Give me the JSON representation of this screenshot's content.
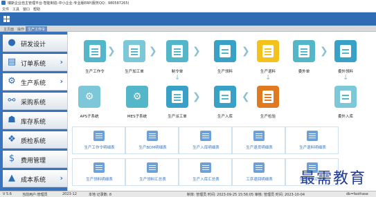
{
  "window": {
    "title": "瑞斯企业自主管理平台-智能制造-中小企业-专业版ERP(服务QQ：980587265)"
  },
  "menu": {
    "items": [
      "文件",
      "工具",
      "窗口",
      "帮助"
    ]
  },
  "tabs": [
    {
      "label": "主页面"
    },
    {
      "label": "操作"
    },
    {
      "label": "生产工作令"
    }
  ],
  "sidebar": {
    "items": [
      {
        "label": "研发设计",
        "icon": "user-icon"
      },
      {
        "label": "订单系统",
        "icon": "orders-icon"
      },
      {
        "label": "生产系统",
        "icon": "gear-icon"
      },
      {
        "label": "采购系统",
        "icon": "cart-icon"
      },
      {
        "label": "库存系统",
        "icon": "warehouse-icon"
      },
      {
        "label": "质检系统",
        "icon": "quality-icon"
      },
      {
        "label": "费用管理",
        "icon": "dollar-icon"
      },
      {
        "label": "成本系统",
        "icon": "chart-icon"
      }
    ]
  },
  "flow": {
    "nodes": [
      {
        "label": "生产工作令",
        "color": "#54b6c9"
      },
      {
        "label": "生产加工单",
        "color": "#7cc8d9"
      },
      {
        "label": "制令单",
        "color": "#54b6c9"
      },
      {
        "label": "生产领料",
        "color": "#3aa1c6"
      },
      {
        "label": "生产退料",
        "color": "#f4c21d"
      },
      {
        "label": "委外单",
        "color": "#54b6c9"
      },
      {
        "label": "委外领料",
        "color": "#3aa1c6"
      },
      {
        "label": "APS子系统",
        "color": "#7cc8d9"
      },
      {
        "label": "MES子系统",
        "color": "#54b6c9"
      },
      {
        "label": "生产派工单",
        "color": "#3aa1c6"
      },
      {
        "label": "生产入库",
        "color": "#3aa1c6"
      },
      {
        "label": "生产检验",
        "color": "#e07a20"
      },
      {
        "label": "委外入库",
        "color": "#7cc8d9"
      }
    ]
  },
  "reports": [
    "生产工作令明细表",
    "生产BOM明细表",
    "生产入库明细表",
    "生产退货明细表",
    "生产退料明细表",
    "生产领料明细表",
    "生产领料汇总表",
    "生产入库汇总表",
    "工序退回明细表",
    "生产退料汇总表"
  ],
  "watermark": "最需教育",
  "status": {
    "version": "V 5.6",
    "user": "当前用户:管理员",
    "period": "2023-12",
    "msg": "本地 记录数: 8",
    "right": "制单: 管理员 时间: 2023-09-25 15:56:05 审核: 管理员 时间: 2023-10-04",
    "db": "db=fasthase"
  }
}
